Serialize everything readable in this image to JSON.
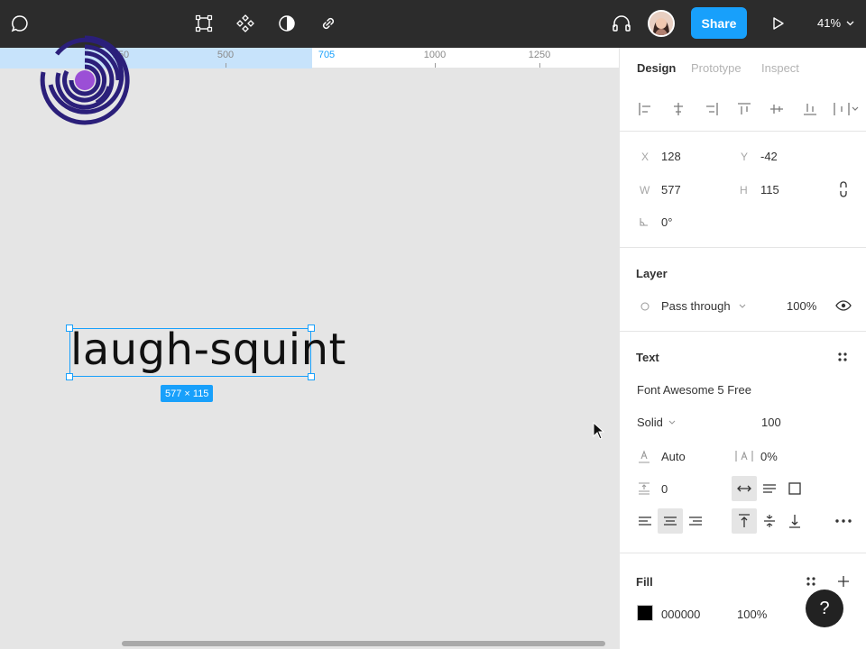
{
  "toolbar": {
    "share_label": "Share",
    "zoom_label": "41%"
  },
  "ruler": {
    "ticks": [
      {
        "label": "250",
        "active": false
      },
      {
        "label": "500",
        "active": false
      },
      {
        "label": "705",
        "active": true
      },
      {
        "label": "1000",
        "active": false
      },
      {
        "label": "1250",
        "active": false
      }
    ]
  },
  "canvas": {
    "selected_text": "laugh-squint",
    "dimensions_badge": "577 × 115",
    "colors": {
      "selection": "#18a0fb",
      "logo_ring": "#2b1f7a",
      "logo_dot": "#9b4fd6"
    }
  },
  "panel": {
    "tabs": [
      "Design",
      "Prototype",
      "Inspect"
    ],
    "transform": {
      "x_label": "X",
      "x_value": "128",
      "y_label": "Y",
      "y_value": "-42",
      "w_label": "W",
      "w_value": "577",
      "h_label": "H",
      "h_value": "115",
      "rotation_value": "0°"
    },
    "layer": {
      "title": "Layer",
      "blend_mode": "Pass through",
      "opacity": "100%"
    },
    "text": {
      "title": "Text",
      "font_family": "Font Awesome 5 Free",
      "font_style": "Solid",
      "font_size": "100",
      "line_height": "Auto",
      "letter_spacing": "0%",
      "paragraph_spacing": "0"
    },
    "fill": {
      "title": "Fill",
      "hex": "000000",
      "opacity": "100%"
    }
  },
  "help": {
    "label": "?"
  }
}
